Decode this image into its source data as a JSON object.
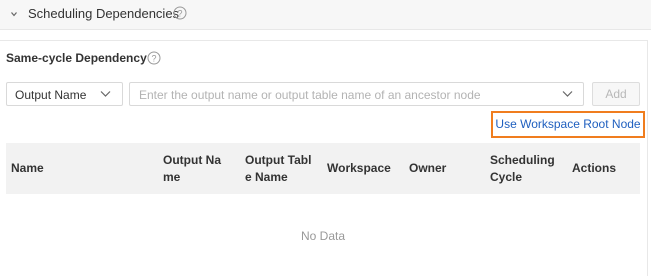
{
  "section": {
    "title": "Scheduling Dependencies"
  },
  "same_cycle": {
    "title": "Same-cycle Dependency",
    "select_value": "Output Name",
    "input_placeholder": "Enter the output name or output table name of an ancestor node",
    "add_label": "Add",
    "root_link": "Use Workspace Root Node"
  },
  "table": {
    "headers": [
      [
        "Name"
      ],
      [
        "Output Na",
        "me"
      ],
      [
        "Output Tabl",
        "e Name"
      ],
      [
        "Workspace"
      ],
      [
        "Owner"
      ],
      [
        "Scheduling",
        "Cycle"
      ],
      [
        "Actions"
      ]
    ],
    "empty_text": "No Data"
  },
  "colors": {
    "highlight": "#f07d1e",
    "link": "#1f5fbf"
  }
}
